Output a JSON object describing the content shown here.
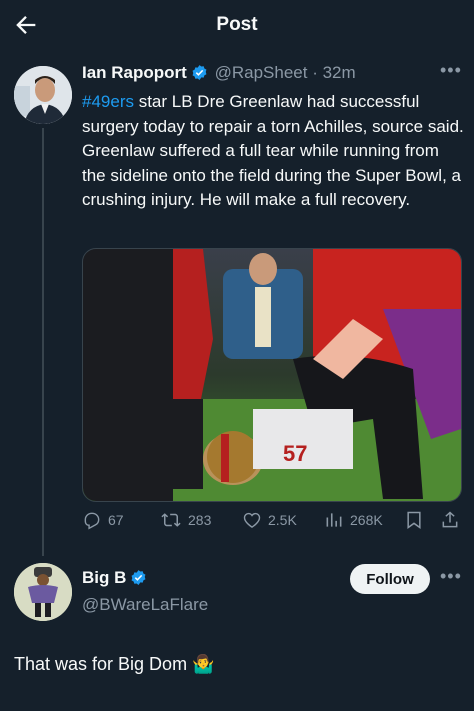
{
  "header": {
    "title": "Post",
    "back_icon": "arrow-left-icon"
  },
  "tweet": {
    "author_name": "Ian Rapoport",
    "handle": "@RapSheet",
    "separator": "·",
    "time": "32m",
    "text_hashtag": "#49ers",
    "text_body": " star LB Dre Greenlaw had successful surgery today to repair a torn Achilles, source said. Greenlaw suffered a full tear while running from the sideline onto the field during the Super Bowl, a crushing injury. He will make a full recovery.",
    "stats": {
      "replies": "67",
      "retweets": "283",
      "likes": "2.5K",
      "views": "268K"
    }
  },
  "reply": {
    "author_name": "Big B",
    "handle": "@BWareLaFlare",
    "follow_label": "Follow",
    "text": "That was for Big Dom",
    "emoji": "🤷‍♂️"
  },
  "colors": {
    "background": "#15202b",
    "accent": "#1d9bf0",
    "muted": "#8b98a5",
    "text": "#f7f9f9"
  }
}
